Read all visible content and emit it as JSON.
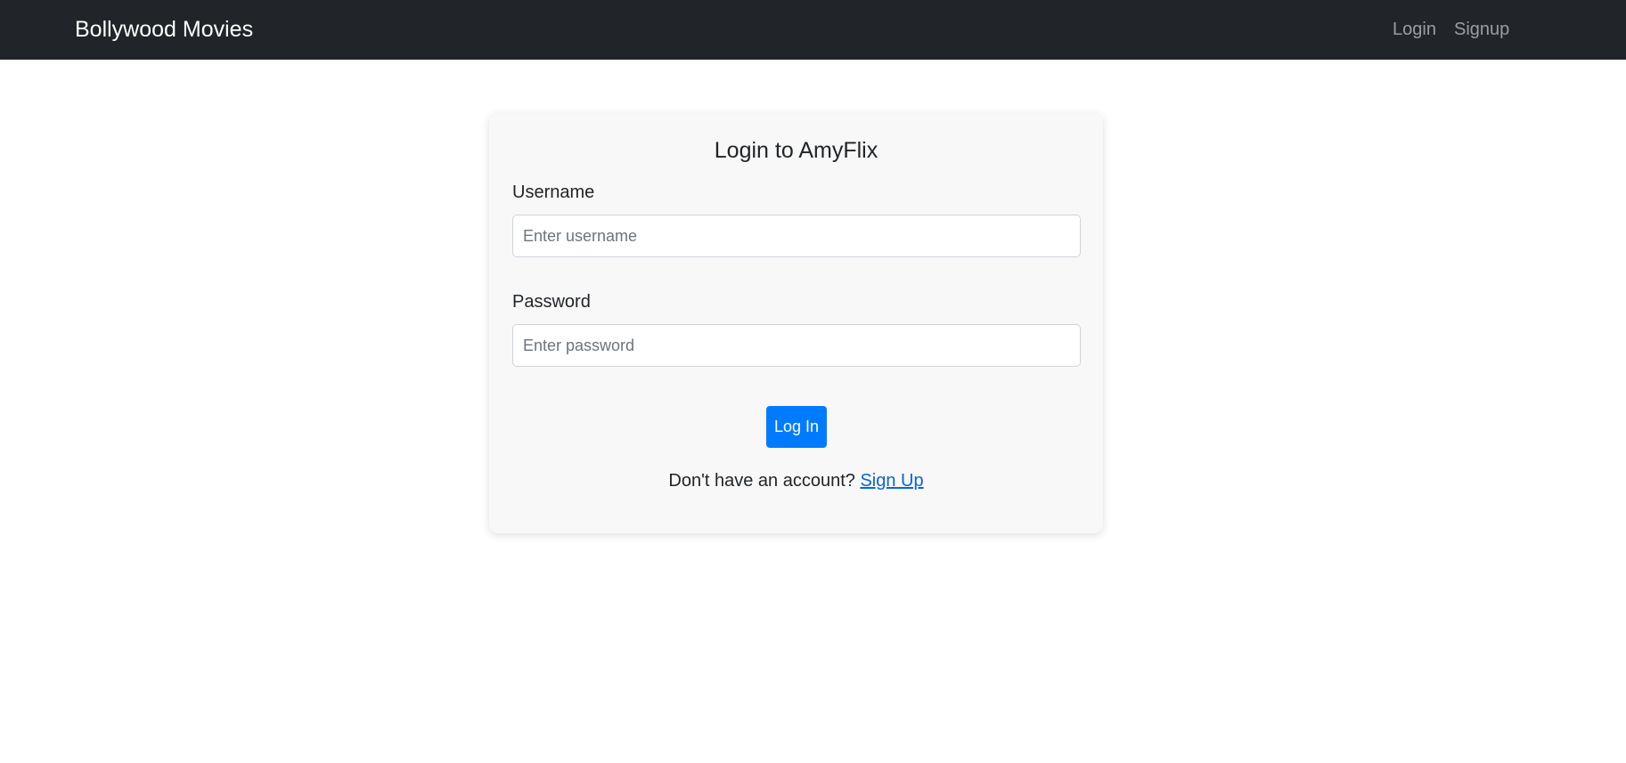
{
  "navbar": {
    "brand": "Bollywood Movies",
    "links": [
      {
        "label": "Login"
      },
      {
        "label": "Signup"
      }
    ]
  },
  "login_card": {
    "title": "Login to AmyFlix",
    "username": {
      "label": "Username",
      "placeholder": "Enter username",
      "value": ""
    },
    "password": {
      "label": "Password",
      "placeholder": "Enter password",
      "value": ""
    },
    "submit_label": "Log In",
    "signup_prompt": "Don't have an account?",
    "signup_link": "Sign Up"
  },
  "colors": {
    "navbar_bg": "#212529",
    "primary": "#007bff",
    "link": "#0b64d8",
    "card_bg": "#f8f8f8"
  }
}
